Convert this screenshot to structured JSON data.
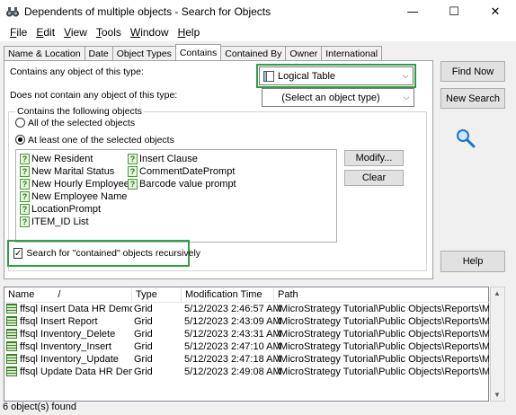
{
  "window": {
    "title": "Dependents of multiple objects - Search for Objects",
    "minimize_glyph": "—",
    "maximize_glyph": "☐",
    "close_glyph": "✕"
  },
  "menu": [
    {
      "key": "F",
      "rest": "ile"
    },
    {
      "key": "E",
      "rest": "dit"
    },
    {
      "key": "V",
      "rest": "iew"
    },
    {
      "key": "T",
      "rest": "ools"
    },
    {
      "key": "W",
      "rest": "indow"
    },
    {
      "key": "H",
      "rest": "elp"
    }
  ],
  "tabs": [
    "Name & Location",
    "Date",
    "Object Types",
    "Contains",
    "Contained By",
    "Owner",
    "International"
  ],
  "contains": {
    "contains_label": "Contains any object of this type:",
    "contains_value": "Logical Table",
    "not_contains_label": "Does not contain any object of this type:",
    "not_contains_value": "(Select an object type)",
    "group_label": "Contains the following objects",
    "radio_all": "All of the selected objects",
    "radio_one": "At least one of the selected objects",
    "objects_col1": [
      "New Resident",
      "New Marital Status",
      "New Hourly Employee",
      "New Employee Name",
      "LocationPrompt",
      "ITEM_ID List"
    ],
    "objects_col2": [
      "Insert Clause",
      "CommentDatePrompt",
      "Barcode value prompt"
    ],
    "modify_button": "Modify...",
    "clear_button": "Clear",
    "recursive_label": "Search for \"contained\" objects recursively"
  },
  "side_buttons": {
    "find_now": "Find Now",
    "new_search": "New Search",
    "help": "Help"
  },
  "results": {
    "columns": [
      "Name",
      "Type",
      "Modification Time",
      "Path"
    ],
    "sort_glyph": "/",
    "rows": [
      {
        "name": "ffsql Insert Data HR Demo",
        "type": "Grid",
        "time": "5/12/2023 2:46:57 AM",
        "path": "\\MicroStrategy Tutorial\\Public Objects\\Reports\\Micr..."
      },
      {
        "name": "ffsql Insert Report",
        "type": "Grid",
        "time": "5/12/2023 2:43:09 AM",
        "path": "\\MicroStrategy Tutorial\\Public Objects\\Reports\\Micr..."
      },
      {
        "name": "ffsql Inventory_Delete",
        "type": "Grid",
        "time": "5/12/2023 2:43:31 AM",
        "path": "\\MicroStrategy Tutorial\\Public Objects\\Reports\\Micr..."
      },
      {
        "name": "ffsql Inventory_Insert",
        "type": "Grid",
        "time": "5/12/2023 2:47:10 AM",
        "path": "\\MicroStrategy Tutorial\\Public Objects\\Reports\\Micr..."
      },
      {
        "name": "ffsql Inventory_Update",
        "type": "Grid",
        "time": "5/12/2023 2:47:18 AM",
        "path": "\\MicroStrategy Tutorial\\Public Objects\\Reports\\Micr..."
      },
      {
        "name": "ffsql Update Data HR Demo",
        "type": "Grid",
        "time": "5/12/2023 2:49:08 AM",
        "path": "\\MicroStrategy Tutorial\\Public Objects\\Reports\\Micr..."
      }
    ]
  },
  "status": "6 object(s) found",
  "colors": {
    "highlight": "#2ea043",
    "search_icon": "#1a73c8"
  }
}
